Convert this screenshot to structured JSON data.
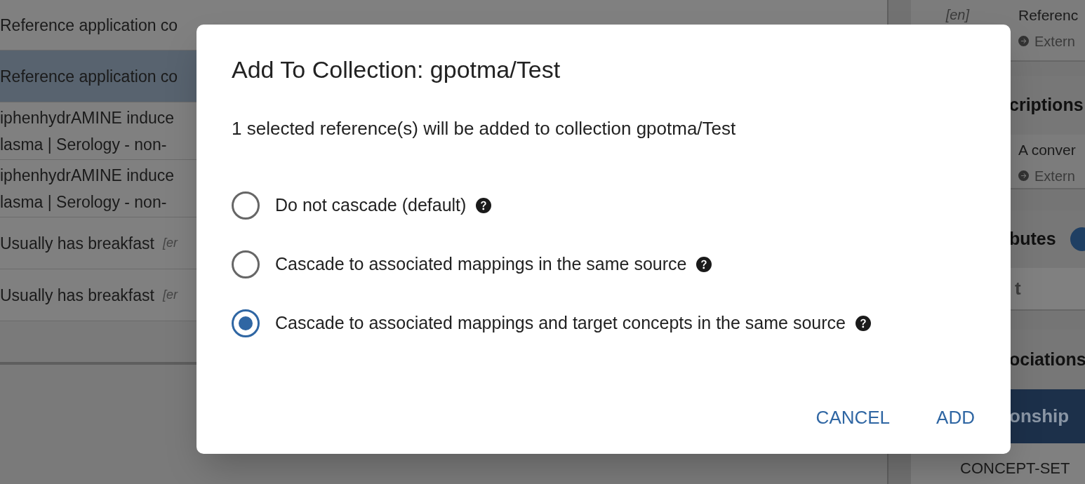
{
  "background_table": {
    "rows": [
      {
        "lines": [
          "Reference application co"
        ],
        "selected": false
      },
      {
        "lines": [
          "Reference application co"
        ],
        "selected": true
      },
      {
        "lines": [
          "iphenhydrAMINE induce",
          "lasma | Serology - non-"
        ],
        "selected": false
      },
      {
        "lines": [
          "iphenhydrAMINE induce",
          "lasma | Serology - non-"
        ],
        "selected": false
      },
      {
        "lines": [
          "Usually has breakfast"
        ],
        "locale": "[er",
        "selected": false
      },
      {
        "lines": [
          "Usually has breakfast"
        ],
        "locale": "[er",
        "selected": false
      }
    ]
  },
  "side_panel": {
    "items": [
      {
        "kind": "entry",
        "locale": "[en]",
        "title": "Referenc",
        "link": "Extern"
      },
      {
        "kind": "header",
        "text": "criptions"
      },
      {
        "kind": "entry",
        "title": "A conver",
        "link": "Extern"
      },
      {
        "kind": "header",
        "text": "butes",
        "badge": true
      },
      {
        "kind": "tab",
        "text": "t"
      },
      {
        "kind": "header",
        "text": "ociations"
      },
      {
        "kind": "column_header",
        "text": "onship"
      },
      {
        "kind": "cell",
        "text": "CONCEPT-SET"
      }
    ]
  },
  "dialog": {
    "title": "Add To Collection: gpotma/Test",
    "message": "1 selected reference(s) will be added to collection gpotma/Test",
    "options": [
      {
        "label": "Do not cascade (default)",
        "selected": false
      },
      {
        "label": "Cascade to associated mappings in the same source",
        "selected": false
      },
      {
        "label": "Cascade to associated mappings and target concepts in the same source",
        "selected": true
      }
    ],
    "buttons": [
      "CANCEL",
      "ADD"
    ]
  }
}
